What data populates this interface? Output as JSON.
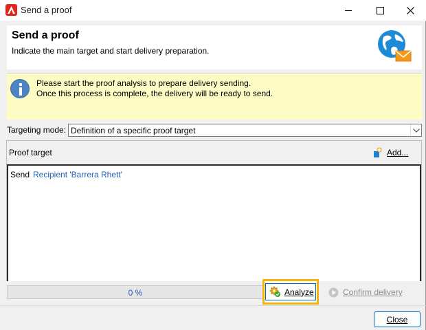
{
  "window": {
    "title": "Send a proof",
    "controls": {
      "minimize": "minimize-icon",
      "maximize": "maximize-icon",
      "close": "close-icon"
    }
  },
  "header": {
    "title": "Send a proof",
    "subtitle": "Indicate the main target and start delivery preparation.",
    "icon": "globe-mail-icon"
  },
  "info": {
    "icon": "info-icon",
    "line1": "Please start the proof analysis to prepare delivery sending.",
    "line2": "Once this process is complete, the delivery will be ready to send.",
    "background": "#fdfcc4"
  },
  "targeting": {
    "label": "Targeting mode:",
    "value": "Definition of a specific proof target"
  },
  "proof_target": {
    "label": "Proof target",
    "add_label": "Add...",
    "send_word": "Send",
    "recipient": "Recipient 'Barrera Rhett'"
  },
  "progress": {
    "text": "0 %",
    "value": 0
  },
  "actions": {
    "analyze_label": "Analyze",
    "confirm_label": "Confirm delivery",
    "close_label": "Close"
  },
  "colors": {
    "highlight": "#f2b50a",
    "link": "#1f5fb4",
    "accent": "#0067c0"
  }
}
